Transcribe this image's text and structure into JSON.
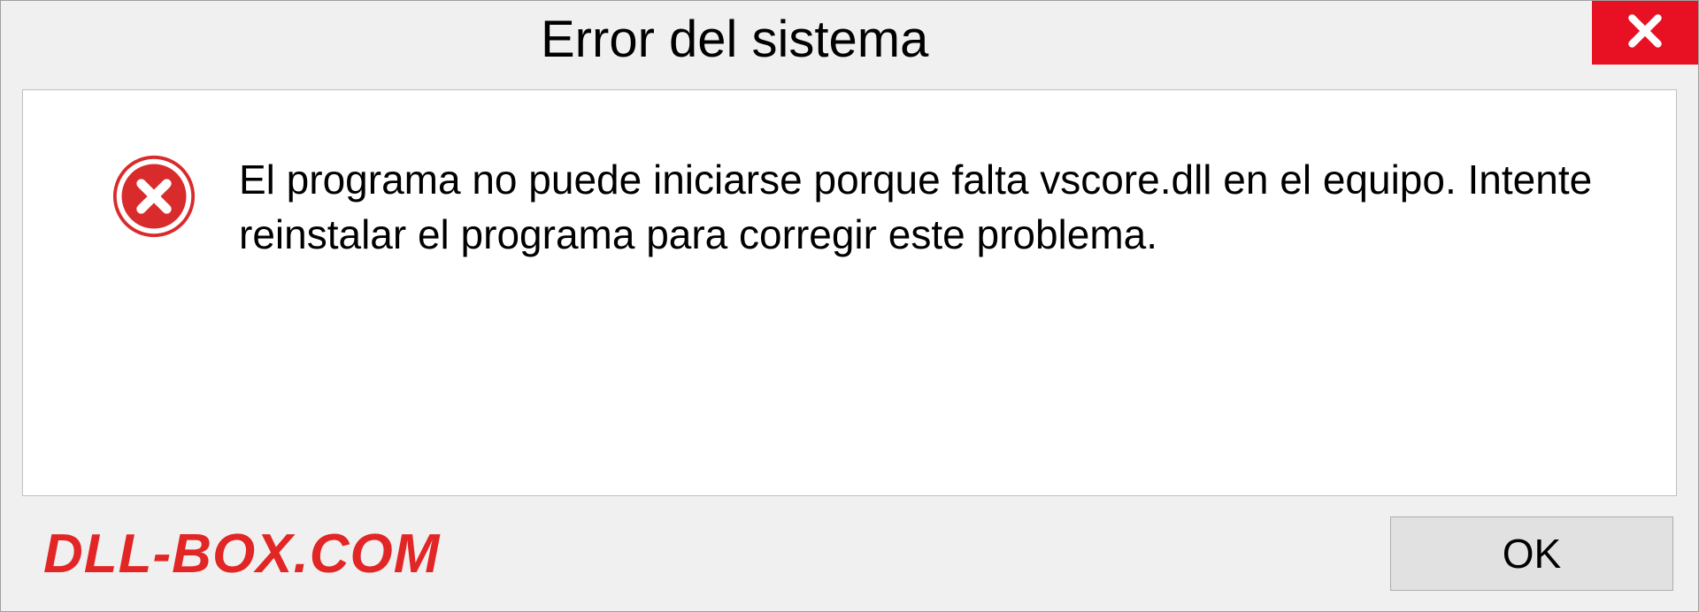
{
  "dialog": {
    "title": "Error del sistema",
    "message": "El programa no puede iniciarse porque falta vscore.dll en el equipo. Intente reinstalar el programa para corregir este problema.",
    "ok_label": "OK"
  },
  "watermark": "DLL-BOX.COM"
}
